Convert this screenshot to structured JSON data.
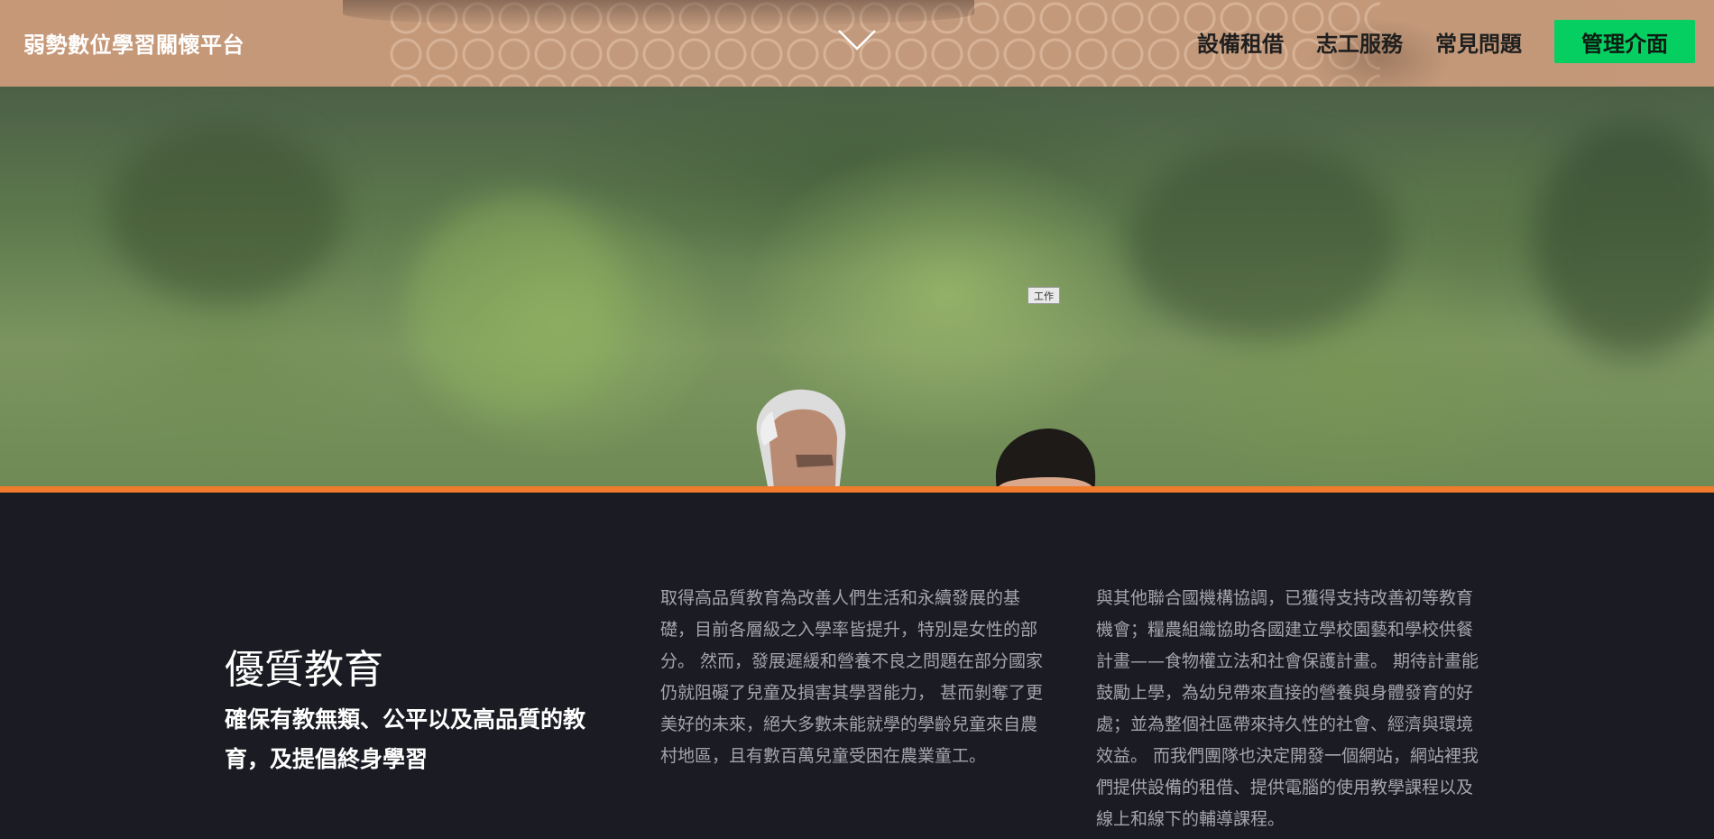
{
  "header": {
    "brand": "弱勢數位學習關懷平台",
    "nav": [
      {
        "label": "設備租借"
      },
      {
        "label": "志工服務"
      },
      {
        "label": "常見問題"
      }
    ],
    "admin_button": "管理介面",
    "menu_toggle_icon": "chevron-down-icon"
  },
  "hero": {
    "tag_label": "工作"
  },
  "colors": {
    "accent_orange": "#f07b2c",
    "admin_green": "#06cf62",
    "dark_bg": "#1b1c23"
  },
  "section": {
    "title": "優質教育",
    "subtitle": "確保有教無類、公平以及高品質的教育，及提倡終身學習",
    "paragraph_1": "取得高品質教育為改善人們生活和永續發展的基礎，目前各層級之入學率皆提升，特別是女性的部分。 然而，發展遲緩和營養不良之問題在部分國家仍就阻礙了兒童及損害其學習能力， 甚而剝奪了更美好的未來，絕大多數未能就學的學齡兒童來自農村地區，且有數百萬兒童受困在農業童工。",
    "paragraph_2": "與其他聯合國機構協調，已獲得支持改善初等教育機會；糧農組織協助各國建立學校園藝和學校供餐計畫——食物權立法和社會保護計畫。 期待計畫能鼓勵上學，為幼兒帶來直接的營養與身體發育的好處；並為整個社區帶來持久性的社會、經濟與環境效益。 而我們團隊也決定開發一個網站，網站裡我們提供設備的租借、提供電腦的使用教學課程以及線上和線下的輔導課程。"
  }
}
